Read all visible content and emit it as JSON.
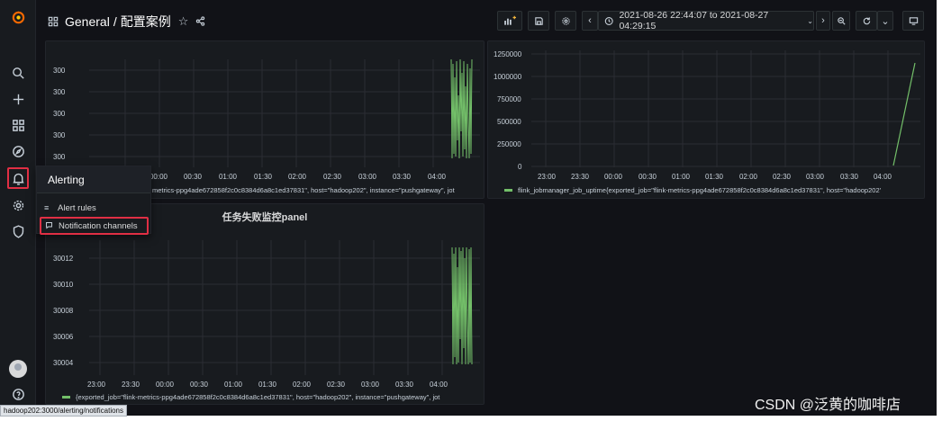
{
  "breadcrumb": {
    "folder": "General",
    "separator": "/",
    "dashboard": "配置案例"
  },
  "time_range": {
    "label": "2021-08-26 22:44:07 to 2021-08-27 04:29:15"
  },
  "alert_menu": {
    "title": "Alerting",
    "items": [
      {
        "label": "Alert rules",
        "icon": "list-icon"
      },
      {
        "label": "Notification channels",
        "icon": "comment-alt-share-icon"
      }
    ]
  },
  "panels": {
    "p1": {
      "title": "",
      "y_ticks": [
        "300",
        "300",
        "300",
        "300",
        "300"
      ],
      "x_ticks": [
        "00:00",
        "00:30",
        "01:00",
        "01:30",
        "02:00",
        "02:30",
        "03:00",
        "03:30",
        "04:00"
      ],
      "legend": "metrics-ppg4ade672858f2c0c8384d6a8c1ed37831\", host=\"hadoop202\", instance=\"pushgateway\", jot"
    },
    "p2": {
      "title": "",
      "y_ticks": [
        "1250000",
        "1000000",
        "750000",
        "500000",
        "250000",
        "0"
      ],
      "x_ticks": [
        "23:00",
        "23:30",
        "00:00",
        "00:30",
        "01:00",
        "01:30",
        "02:00",
        "02:30",
        "03:00",
        "03:30",
        "04:00"
      ],
      "legend": "flink_jobmanager_job_uptime{exported_job=\"flink-metrics-ppg4ade672858f2c0c8384d6a8c1ed37831\", host=\"hadoop202'"
    },
    "p3": {
      "title": "任务失败监控panel",
      "y_ticks": [
        "30012",
        "30010",
        "30008",
        "30006",
        "30004"
      ],
      "x_ticks": [
        "23:00",
        "23:30",
        "00:00",
        "00:30",
        "01:00",
        "01:30",
        "02:00",
        "02:30",
        "03:00",
        "03:30",
        "04:00"
      ],
      "legend": "{exported_job=\"flink-metrics-ppg4ade672858f2c0c8384d6a8c1ed37831\", host=\"hadoop202\", instance=\"pushgateway\", jot"
    }
  },
  "status_url": "hadoop202:3000/alerting/notifications",
  "watermark": "CSDN @泛黄的咖啡店",
  "colors": {
    "series": "#73bf69",
    "highlight": "#e02f44",
    "background": "#111217",
    "panel": "#181b1f"
  }
}
